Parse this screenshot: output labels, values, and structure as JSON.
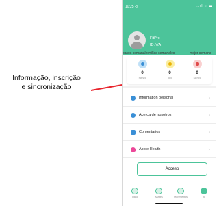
{
  "annotation": {
    "line1": "Informação, inscrição",
    "line2": "e sincronização",
    "line_color": "#e8242c"
  },
  "status_bar": {
    "time": "10:25 ⊲",
    "icons": "..ıl ≈ ▬"
  },
  "profile": {
    "name": "FitPro",
    "id": "ID:N/A"
  },
  "stats": {
    "labels": [
      "pasos semanales",
      "millas semanales",
      "mejor semana"
    ],
    "items": [
      {
        "value": "0",
        "unit": "steps",
        "icon": "footsteps-icon",
        "color": "#3a8fd6"
      },
      {
        "value": "0",
        "unit": "km",
        "icon": "distance-icon",
        "color": "#eab308"
      },
      {
        "value": "0",
        "unit": "steps",
        "icon": "calendar-icon",
        "color": "#e04a4a"
      }
    ]
  },
  "menu": [
    {
      "label": "Information personal",
      "icon": "person-icon",
      "color": "#3a8fd6"
    },
    {
      "label": "Acerca de nosotros",
      "icon": "info-icon",
      "color": "#3a8fd6"
    },
    {
      "label": "Comentarios",
      "icon": "feedback-icon",
      "color": "#3a8fd6"
    },
    {
      "label": "Apple Health",
      "icon": "heart-icon",
      "color": "#ec4899"
    }
  ],
  "accept_button": "Acceso",
  "tabs": [
    {
      "label": "Inicio",
      "icon": "home-icon"
    },
    {
      "label": "Ajustes",
      "icon": "settings-icon"
    },
    {
      "label": "Movimientos",
      "icon": "activity-icon"
    },
    {
      "label": "Yo",
      "icon": "profile-icon",
      "active": true
    }
  ],
  "colors": {
    "accent": "#4cc49a"
  }
}
